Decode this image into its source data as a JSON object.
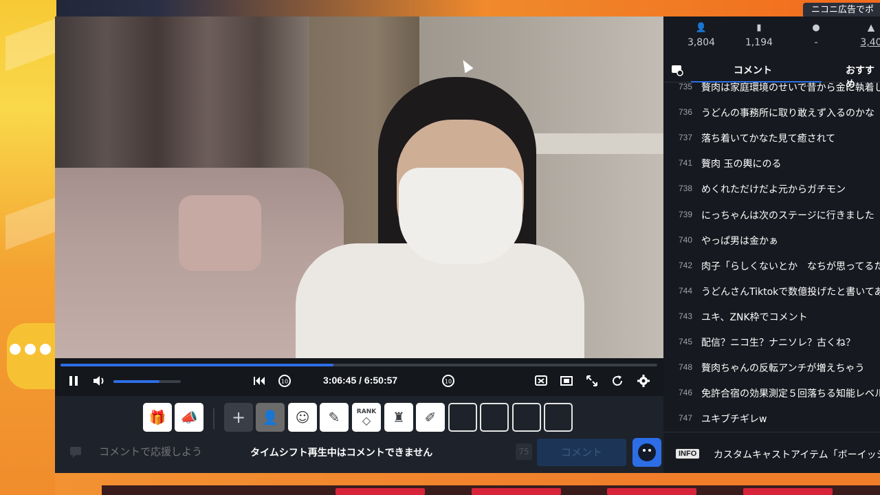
{
  "ad_banner": {
    "text": "ニコニ広告でポ"
  },
  "player": {
    "current_time": "3:06:45",
    "duration": "6:50:57",
    "time_display": "3:06:45 / 6:50:57",
    "progress_fraction": 0.457,
    "volume_fraction": 0.68,
    "accent_color": "#2d6ee6"
  },
  "items": {
    "rank_label": "RANK",
    "plus_label": "+"
  },
  "comment_bar": {
    "placeholder": "コメントで応援しよう",
    "notice": "タイムシフト再生中はコメントできません",
    "char_limit": "75",
    "submit_label": "コメント"
  },
  "stats": {
    "viewers": "3,804",
    "comments": "1,194",
    "time": "-",
    "points": "3,40"
  },
  "tabs": {
    "comment": "コメント",
    "recommend": "おすすめ"
  },
  "comments": [
    {
      "num": "735",
      "text": "贅肉は家庭環境のせいで昔から金に執着し"
    },
    {
      "num": "736",
      "text": "うどんの事務所に取り敢えず入るのかな"
    },
    {
      "num": "737",
      "text": "落ち着いてかなた見て癒されて"
    },
    {
      "num": "741",
      "text": "贅肉 玉の輿にのる"
    },
    {
      "num": "738",
      "text": "めくれただけだよ元からガチモン"
    },
    {
      "num": "739",
      "text": "にっちゃんは次のステージに行きました"
    },
    {
      "num": "740",
      "text": "やっぱ男は金かぁ"
    },
    {
      "num": "742",
      "text": "肉子「らしくないとか　なちが思ってるた"
    },
    {
      "num": "744",
      "text": "うどんさんTiktokで数億投げたと書いてあ"
    },
    {
      "num": "743",
      "text": "ユキ、ZNK枠でコメント"
    },
    {
      "num": "745",
      "text": "配信？ニコ生？ナニソレ？古くね？"
    },
    {
      "num": "748",
      "text": "贅肉ちゃんの反転アンチが増えちゃう"
    },
    {
      "num": "746",
      "text": "免許合宿の効果測定５回落ちる知能レベル"
    },
    {
      "num": "747",
      "text": "ユキブチギレw"
    }
  ],
  "info": {
    "badge": "INFO",
    "text": "カスタムキャストアイテム「ボーイッシュ"
  }
}
